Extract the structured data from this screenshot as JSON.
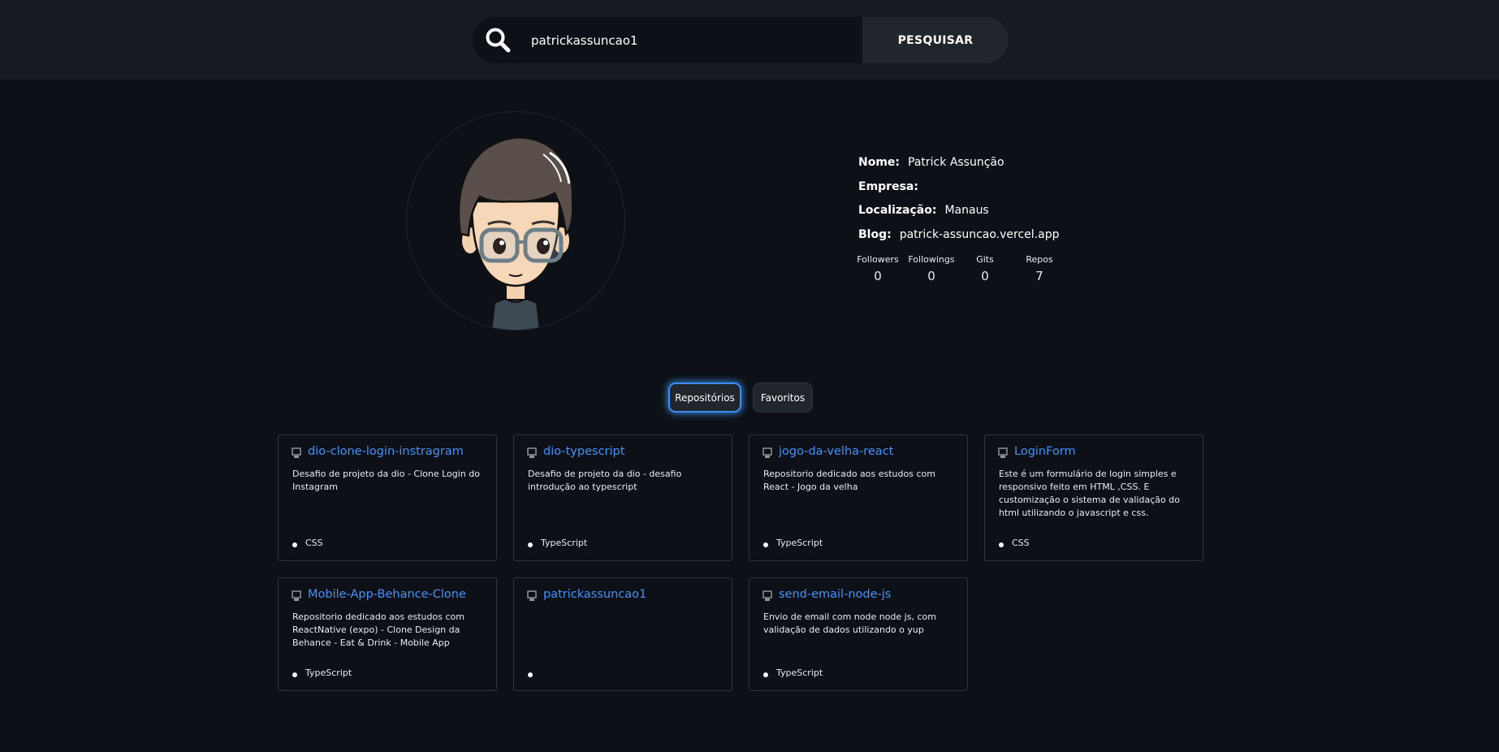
{
  "search": {
    "value": "patrickassuncao1",
    "placeholder": "",
    "button_label": "PESQUISAR"
  },
  "profile": {
    "avatar_icon": "cartoon-avatar",
    "name_label": "Nome:",
    "name": "Patrick Assunção",
    "company_label": "Empresa:",
    "company": "",
    "location_label": "Localização:",
    "location": "Manaus",
    "blog_label": "Blog:",
    "blog": "patrick-assuncao.vercel.app"
  },
  "stats": [
    {
      "label": "Followers",
      "value": "0"
    },
    {
      "label": "Followings",
      "value": "0"
    },
    {
      "label": "Gits",
      "value": "0"
    },
    {
      "label": "Repos",
      "value": "7"
    }
  ],
  "tabs": {
    "repos": "Repositórios",
    "favorites": "Favoritos",
    "active": "repos"
  },
  "repos": [
    {
      "name": "dio-clone-login-instragram",
      "description": "Desafio de projeto da dio - Clone Login do Instagram",
      "language": "CSS"
    },
    {
      "name": "dio-typescript",
      "description": "Desafio de projeto da dio - desafio introdução ao typescript",
      "language": "TypeScript"
    },
    {
      "name": "jogo-da-velha-react",
      "description": "Repositorio dedicado aos estudos com React - Jogo da velha",
      "language": "TypeScript"
    },
    {
      "name": "LoginForm",
      "description": "Este é um formulário de login simples e responsivo feito em HTML ,CSS. E customização o sistema de validação do html utilizando o javascript e css.",
      "language": "CSS"
    },
    {
      "name": "Mobile-App-Behance-Clone",
      "description": "Repositorio dedicado aos estudos com ReactNative (expo) - Clone Design da Behance - Eat & Drink - Mobile App",
      "language": "TypeScript"
    },
    {
      "name": "patrickassuncao1",
      "description": "",
      "language": ""
    },
    {
      "name": "send-email-node-js",
      "description": "Envio de email com node node js, com validação de dados utilizando o yup",
      "language": "TypeScript"
    }
  ],
  "colors": {
    "background": "#0d1117",
    "topbar": "#161b22",
    "accent_link": "#4493f8",
    "active_tab_glow": "#3b8df0"
  }
}
